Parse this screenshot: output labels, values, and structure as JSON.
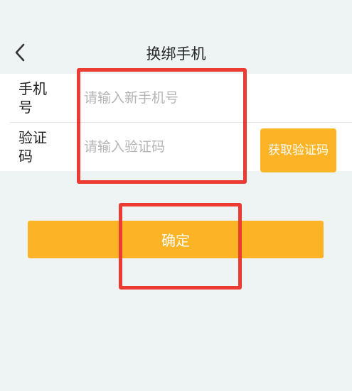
{
  "header": {
    "title": "换绑手机",
    "back_icon": "chevron-left-icon"
  },
  "form": {
    "phone": {
      "label": "手机号",
      "placeholder": "请输入新手机号",
      "value": ""
    },
    "code": {
      "label": "验证码",
      "placeholder": "请输入验证码",
      "value": "",
      "send_button_label": "获取验证码"
    }
  },
  "confirm_button_label": "确定",
  "colors": {
    "accent": "#fcb426",
    "highlight": "#ec3b33",
    "background": "#eef3f3"
  }
}
